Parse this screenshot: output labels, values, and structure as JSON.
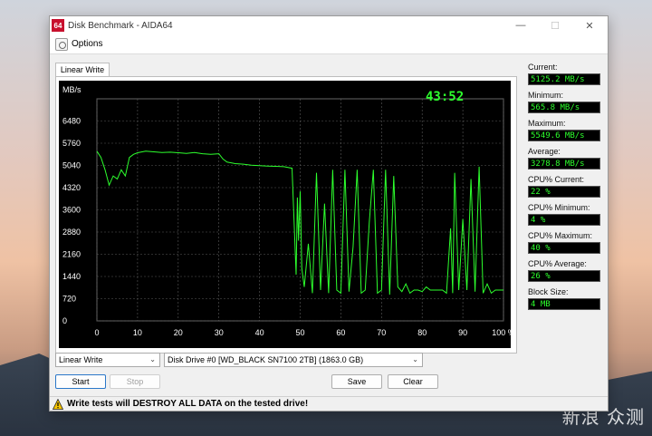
{
  "window": {
    "icon_text": "64",
    "title": "Disk Benchmark - AIDA64",
    "minimize": "—",
    "maximize": "☐",
    "close": "✕"
  },
  "menu": {
    "options_label": "Options"
  },
  "tab": {
    "label": "Linear Write"
  },
  "chart_data": {
    "type": "line",
    "timer": "43:52",
    "ylabel": "MB/s",
    "y_ticks": [
      6480,
      5760,
      5040,
      4320,
      3600,
      2880,
      2160,
      1440,
      720,
      0
    ],
    "x_ticks": [
      "0",
      "10",
      "20",
      "30",
      "40",
      "50",
      "60",
      "70",
      "80",
      "90",
      "100 %"
    ],
    "xlim": [
      0,
      100
    ],
    "ylim": [
      0,
      7200
    ],
    "line_color": "#2dff2d",
    "series": [
      {
        "x": [
          0,
          1,
          2,
          3,
          4,
          5,
          6,
          7,
          8,
          9,
          10,
          12,
          14,
          16,
          18,
          20,
          22,
          24,
          26,
          28,
          30,
          31,
          32,
          34,
          36,
          38,
          40,
          42,
          44,
          46,
          48,
          49,
          49.3,
          49.6,
          50,
          50.4,
          51,
          52,
          53,
          54,
          55,
          56,
          57,
          58,
          59,
          60,
          61,
          62,
          63,
          64,
          65,
          66,
          67,
          68,
          69,
          70,
          71,
          72,
          73,
          74,
          75,
          76,
          77,
          78,
          79,
          80,
          81,
          82,
          83,
          84,
          85,
          86,
          87,
          87.5,
          88,
          89,
          90,
          91,
          92,
          93,
          94,
          95,
          96,
          97,
          98,
          99,
          100
        ],
        "y": [
          5500,
          5300,
          4900,
          4400,
          4700,
          4600,
          4900,
          4700,
          5300,
          5400,
          5450,
          5500,
          5480,
          5460,
          5470,
          5450,
          5430,
          5460,
          5420,
          5400,
          5420,
          5250,
          5150,
          5100,
          5080,
          5050,
          5030,
          5020,
          5010,
          5000,
          4950,
          1500,
          4000,
          2600,
          4200,
          1700,
          1100,
          2500,
          900,
          4800,
          1000,
          3800,
          900,
          4900,
          1000,
          900,
          4900,
          950,
          2400,
          4900,
          900,
          1000,
          3200,
          4900,
          900,
          1000,
          4900,
          850,
          4700,
          1100,
          950,
          1200,
          900,
          1000,
          1000,
          950,
          1100,
          1000,
          1000,
          1000,
          1000,
          900,
          3000,
          900,
          4800,
          1000,
          3300,
          1000,
          4600,
          950,
          5000,
          900,
          1200,
          900,
          1000,
          1000,
          1000
        ]
      }
    ]
  },
  "stats": [
    {
      "label": "Current:",
      "value": "5125.2 MB/s"
    },
    {
      "label": "Minimum:",
      "value": "565.8 MB/s"
    },
    {
      "label": "Maximum:",
      "value": "5549.6 MB/s"
    },
    {
      "label": "Average:",
      "value": "3278.8 MB/s"
    },
    {
      "label": "CPU% Current:",
      "value": "22 %"
    },
    {
      "label": "CPU% Minimum:",
      "value": "4 %"
    },
    {
      "label": "CPU% Maximum:",
      "value": "40 %"
    },
    {
      "label": "CPU% Average:",
      "value": "26 %"
    },
    {
      "label": "Block Size:",
      "value": "4 MB"
    }
  ],
  "controls": {
    "test_select": "Linear Write",
    "drive_select": "Disk Drive #0  [WD_BLACK SN7100 2TB]  (1863.0 GB)",
    "start": "Start",
    "stop": "Stop",
    "save": "Save",
    "clear": "Clear"
  },
  "status": {
    "warning": "Write tests will DESTROY ALL DATA on the tested drive!"
  },
  "watermark": "新浪 众测"
}
